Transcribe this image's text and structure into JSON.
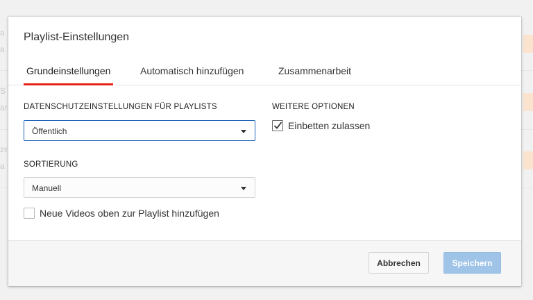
{
  "background": {
    "fragments": [
      "a",
      "a",
      "S",
      "ar",
      "ze",
      "a"
    ]
  },
  "dialog": {
    "title": "Playlist-Einstellungen",
    "tabs": [
      {
        "label": "Grundeinstellungen",
        "active": true
      },
      {
        "label": "Automatisch hinzufügen",
        "active": false
      },
      {
        "label": "Zusammenarbeit",
        "active": false
      }
    ],
    "privacy": {
      "label": "DATENSCHUTZEINSTELLUNGEN FÜR PLAYLISTS",
      "selected": "Öffentlich"
    },
    "sorting": {
      "label": "SORTIERUNG",
      "selected": "Manuell"
    },
    "add_to_top": {
      "label": "Neue Videos oben zur Playlist hinzufügen",
      "checked": false
    },
    "more_options": {
      "label": "WEITERE OPTIONEN",
      "embed": {
        "label": "Einbetten zulassen",
        "checked": true
      }
    },
    "footer": {
      "cancel_label": "Abbrechen",
      "save_label": "Speichern"
    }
  },
  "colors": {
    "tab_active_underline": "#e62117",
    "select_focus_border": "#1c62b9",
    "save_button_bg": "#a0c4e8",
    "background_accent": "#fbe3cf"
  }
}
